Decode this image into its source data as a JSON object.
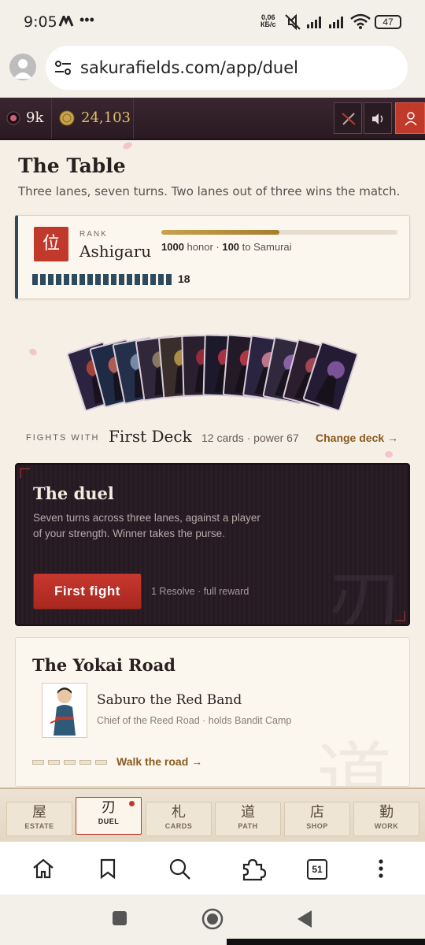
{
  "status": {
    "time": "9:05",
    "net_speed_top": "0,06",
    "net_speed_bottom": "КБ/с",
    "battery": "47"
  },
  "browser": {
    "url": "sakurafields.com/app/duel",
    "tabs_count": "51"
  },
  "topbar": {
    "gems": "9k",
    "coins": "24,103"
  },
  "page": {
    "title": "The Table",
    "subtitle": "Three lanes, seven turns. Two lanes out of three wins the match.",
    "rank": {
      "badge": "位",
      "label": "RANK",
      "name": "Ashigaru",
      "honor_value": "1000",
      "honor_unit": " honor · ",
      "next_value": "100",
      "next_text": " to Samurai",
      "progress": 0.5,
      "segments": 18,
      "count": "18"
    },
    "deck": {
      "fights_label": "FIGHTS WITH",
      "name": "First Deck",
      "meta": "12 cards · power 67",
      "change": "Change deck →"
    },
    "duel": {
      "title": "The duel",
      "desc": "Seven turns across three lanes, against a player of your strength. Winner takes the purse.",
      "button": "First fight",
      "meta": "1 Resolve · full reward",
      "watermark": "刃"
    },
    "road": {
      "title": "The Yokai Road",
      "boss_name": "Saburo the Red Band",
      "boss_sub": "Chief of the Reed Road · holds Bandit Camp",
      "walk": "Walk the road →",
      "watermark": "道",
      "pips": 5
    }
  },
  "nav": [
    {
      "kanji": "屋",
      "label": "ESTATE"
    },
    {
      "kanji": "刃",
      "label": "DUEL"
    },
    {
      "kanji": "札",
      "label": "CARDS"
    },
    {
      "kanji": "道",
      "label": "PATH"
    },
    {
      "kanji": "店",
      "label": "SHOP"
    },
    {
      "kanji": "勤",
      "label": "WORK"
    }
  ],
  "colors": {
    "accent_red": "#c0392b",
    "gold": "#8a5a1e",
    "dark_panel": "#2a1d26",
    "rank_blue": "#2e4a5e"
  }
}
